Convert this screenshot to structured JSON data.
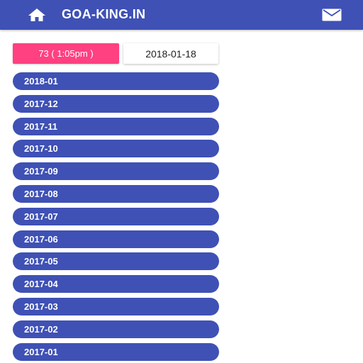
{
  "header": {
    "title": "GOA-KING.IN",
    "home_icon": "home-icon",
    "mail_icon": "mail-icon",
    "bg_color": "#3f51b5"
  },
  "result": {
    "label": "73 ( 1:05pm )",
    "color": "#ff4081"
  },
  "date": {
    "label": "2018-01-18"
  },
  "months": {
    "color": "#3f51b5",
    "items": [
      "2018-01",
      "2017-12",
      "2017-11",
      "2017-10",
      "2017-09",
      "2017-08",
      "2017-07",
      "2017-06",
      "2017-05",
      "2017-04",
      "2017-03",
      "2017-02",
      "2017-01"
    ]
  }
}
